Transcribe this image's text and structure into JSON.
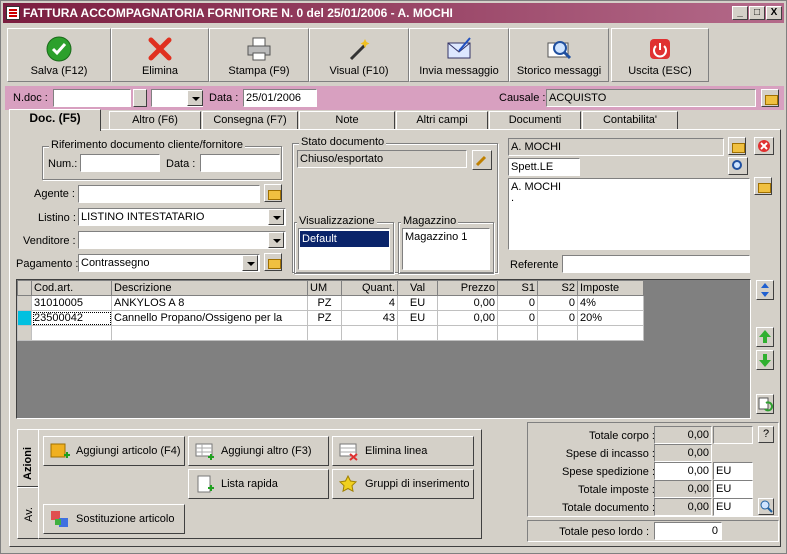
{
  "window": {
    "title": "FATTURA ACCOMPAGNATORIA FORNITORE N. 0  del 25/01/2006 - A. MOCHI",
    "minimize": "_",
    "maximize": "□",
    "close": "X"
  },
  "toolbar": {
    "buttons": [
      {
        "label": "Salva (F12)",
        "icon": "check-icon"
      },
      {
        "label": "Elimina",
        "icon": "delete-icon"
      },
      {
        "label": "Stampa (F9)",
        "icon": "printer-icon"
      },
      {
        "label": "Visual (F10)",
        "icon": "magic-wand-icon"
      },
      {
        "label": "Invia messaggio",
        "icon": "envelope-icon"
      },
      {
        "label": "Storico messaggi",
        "icon": "search-mail-icon"
      },
      {
        "label": "Uscita (ESC)",
        "icon": "power-icon"
      }
    ]
  },
  "header": {
    "ndoc_label": "N.doc :",
    "ndoc_value": "",
    "data_label": "Data :",
    "data_value": "25/01/2006",
    "causale_label": "Causale :",
    "causale_value": "ACQUISTO"
  },
  "tabs": [
    "Doc. (F5)",
    "Altro (F6)",
    "Consegna (F7)",
    "Note",
    "Altri campi",
    "Documenti",
    "Contabilita'"
  ],
  "doc": {
    "rif_title": "Riferimento documento cliente/fornitore",
    "num_label": "Num.:",
    "num_value": "",
    "data_label": "Data :",
    "data_value": "",
    "agente_label": "Agente :",
    "agente_value": "",
    "listino_label": "Listino :",
    "listino_value": "LISTINO INTESTATARIO",
    "venditore_label": "Venditore :",
    "venditore_value": "",
    "pagamento_label": "Pagamento :",
    "pagamento_value": "Contrassegno",
    "stato_title": "Stato documento",
    "stato_value": "Chiuso/esportato",
    "visual_title": "Visualizzazione",
    "visual_value": "Default",
    "magazzino_title": "Magazzino",
    "magazzino_value": "Magazzino 1",
    "cliente_name": "A. MOCHI",
    "cliente_salutation": "Spett.LE",
    "cliente_address": "A. MOCHI",
    "cliente_address2": ".",
    "referente_label": "Referente",
    "referente_value": ""
  },
  "grid": {
    "columns": [
      "Cod.art.",
      "Descrizione",
      "UM",
      "Quant.",
      "Val",
      "Prezzo",
      "S1",
      "S2",
      "Imposte"
    ],
    "rows": [
      [
        "31010005",
        "ANKYLOS A 8",
        "PZ",
        "4",
        "EU",
        "0,00",
        "0",
        "0",
        "4%"
      ],
      [
        "23500042",
        "Cannello Propano/Ossigeno per la",
        "PZ",
        "43",
        "EU",
        "0,00",
        "0",
        "0",
        "20%"
      ]
    ]
  },
  "actions": {
    "tab_azioni": "Azioni",
    "tab_av": "Av.",
    "aggiungi_articolo": "Aggiungi articolo (F4)",
    "aggiungi_altro": "Aggiungi altro (F3)",
    "elimina_linea": "Elimina linea",
    "lista_rapida": "Lista rapida",
    "gruppi_inserimento": "Gruppi di inserimento",
    "sostituzione_articolo": "Sostituzione articolo"
  },
  "totals": {
    "totale_corpo_label": "Totale corpo :",
    "totale_corpo": "0,00",
    "help": "?",
    "spese_incasso_label": "Spese di incasso :",
    "spese_incasso": "0,00",
    "spese_spedizione_label": "Spese spedizione :",
    "spese_spedizione": "0,00",
    "spese_spedizione_cur": "EU",
    "totale_imposte_label": "Totale imposte :",
    "totale_imposte": "0,00",
    "totale_imposte_cur": "EU",
    "totale_documento_label": "Totale documento :",
    "totale_documento": "0,00",
    "totale_documento_cur": "EU",
    "peso_label": "Totale peso lordo :",
    "peso_value": "0"
  }
}
